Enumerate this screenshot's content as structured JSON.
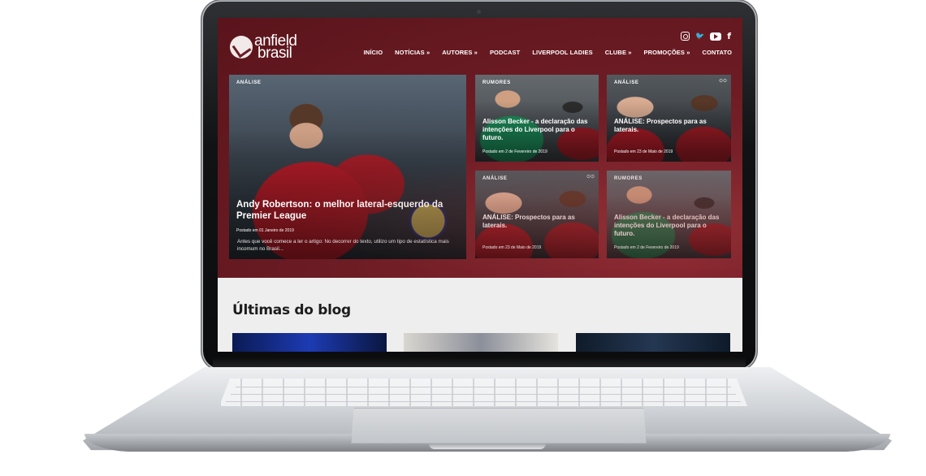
{
  "site": {
    "logo_line1": "anfield",
    "logo_line2": "brasil"
  },
  "social": {
    "icons": [
      "instagram-icon",
      "twitter-icon",
      "youtube-icon",
      "facebook-icon"
    ],
    "twitter_glyph": "🐦",
    "facebook_glyph": "f"
  },
  "nav": {
    "items": [
      "INÍCIO",
      "NOTÍCIAS »",
      "AUTORES »",
      "PODCAST",
      "LIVERPOOL LADIES",
      "CLUBE »",
      "PROMOÇÕES »",
      "CONTATO"
    ]
  },
  "featured": {
    "main": {
      "tag": "ANÁLISE",
      "title": "Andy Robertson: o melhor lateral-esquerdo da Premier League",
      "date": "Postado em 01 Janeiro de 2019",
      "excerpt": "Antes que você comece a ler o artigo: No decorrer do texto, utilizo um tipo de estatística mais incomum no Brasil..."
    },
    "cards": [
      {
        "tag": "RUMORES",
        "title": "Alisson Becker - a declaração das intenções do Liverpool para o futuro.",
        "date": "Postado em 2 de Fevereiro de 2019"
      },
      {
        "tag": "ANÁLISE",
        "title": "ANÁLISE: Prospectos para as laterais.",
        "date": "Postado em 23 de Maio de 2019"
      },
      {
        "tag": "ANÁLISE",
        "title": "ANÁLISE: Prospectos para as laterais.",
        "date": "Postado em 23 de Maio de 2019"
      },
      {
        "tag": "RUMORES",
        "title": "Alisson Becker - a declaração das intenções do Liverpool para o futuro.",
        "date": "Postado em 2 de Fevereiro de 2019"
      }
    ]
  },
  "blog": {
    "heading": "Últimas do blog"
  },
  "colors": {
    "brand": "#6b1b23",
    "background": "#eeeeee"
  }
}
